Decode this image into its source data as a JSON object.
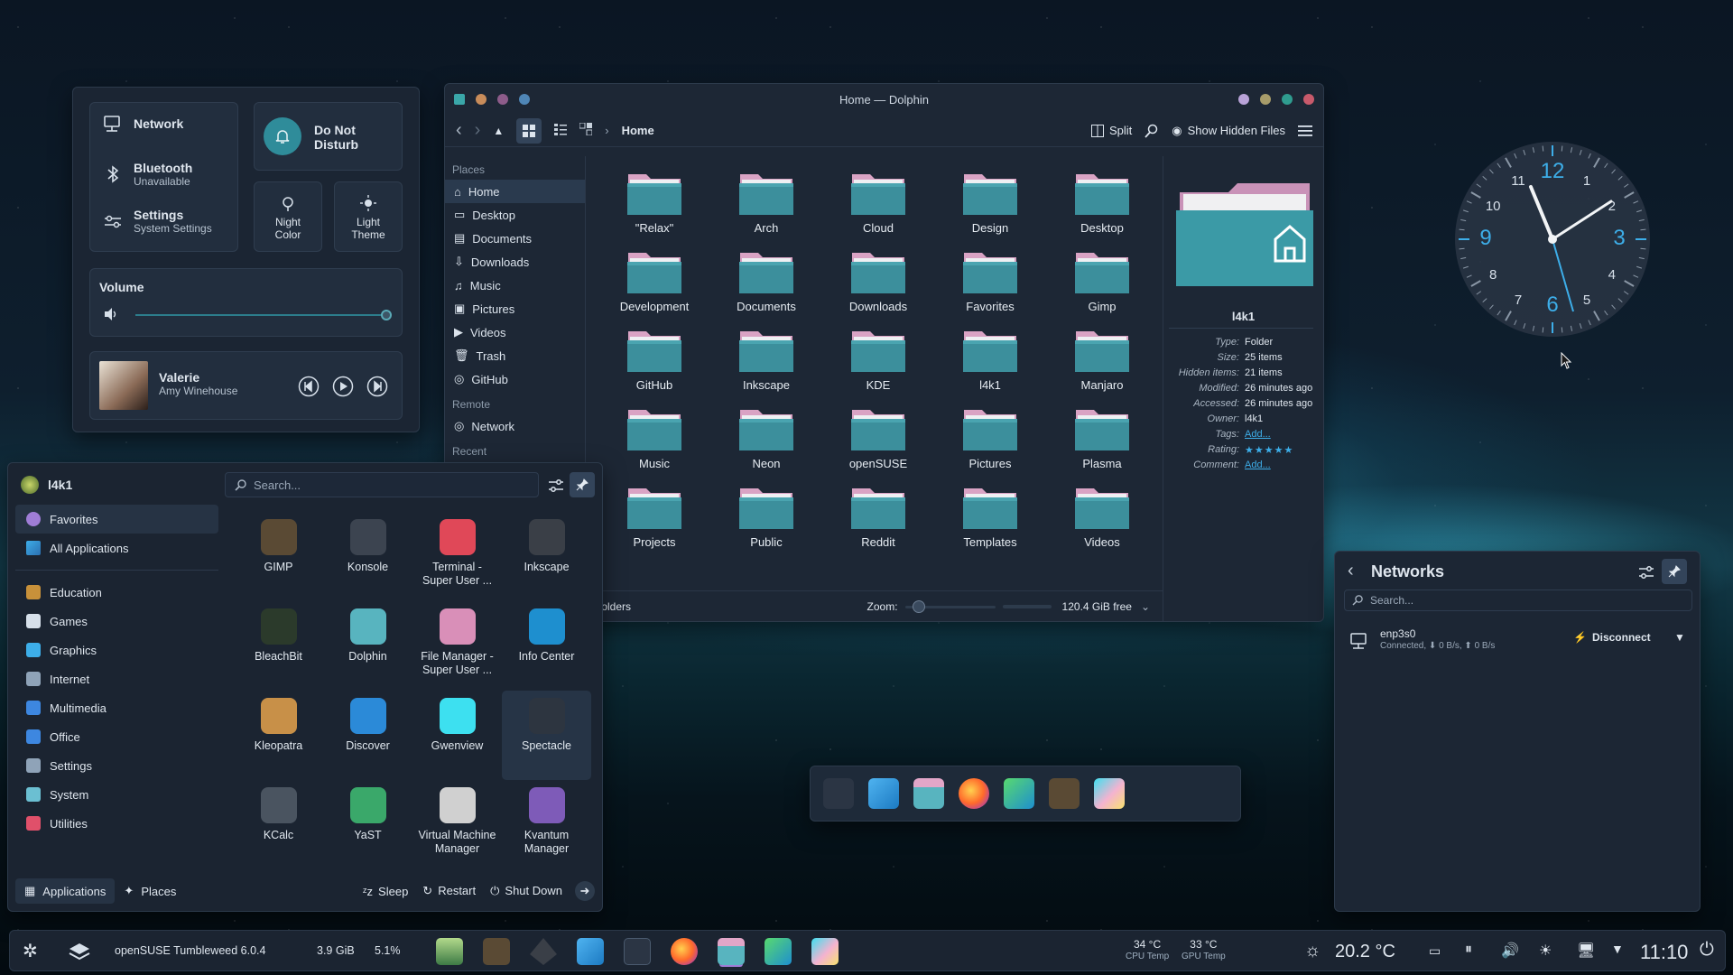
{
  "quick_settings": {
    "network_label": "Network",
    "bluetooth_label": "Bluetooth",
    "bluetooth_status": "Unavailable",
    "settings_label": "Settings",
    "settings_sub": "System Settings",
    "dnd_label_1": "Do Not",
    "dnd_label_2": "Disturb",
    "night_label_1": "Night",
    "night_label_2": "Color",
    "light_label_1": "Light",
    "light_label_2": "Theme",
    "volume_label": "Volume",
    "volume_level": 1.0,
    "media_title": "Valerie",
    "media_artist": "Amy Winehouse"
  },
  "dolphin": {
    "title": "Home — Dolphin",
    "breadcrumb": "Home",
    "split_label": "Split",
    "hidden_label": "Show Hidden Files",
    "places_header": "Places",
    "places": [
      "Home",
      "Desktop",
      "Documents",
      "Downloads",
      "Music",
      "Pictures",
      "Videos",
      "Trash",
      "GitHub"
    ],
    "remote_header": "Remote",
    "remote": [
      "Network"
    ],
    "recent_header": "Recent",
    "folders": [
      "\"Relax\"",
      "Arch",
      "Cloud",
      "Design",
      "Desktop",
      "Development",
      "Documents",
      "Downloads",
      "Favorites",
      "Gimp",
      "GitHub",
      "Inkscape",
      "KDE",
      "l4k1",
      "Manjaro",
      "Music",
      "Neon",
      "openSUSE",
      "Pictures",
      "Plasma",
      "Projects",
      "Public",
      "Reddit",
      "Templates",
      "Videos"
    ],
    "status_text": "folders",
    "zoom_label": "Zoom:",
    "zoom_level": 0.1,
    "free_space": "120.4 GiB free",
    "info": {
      "name": "l4k1",
      "rows": [
        [
          "Type:",
          "Folder"
        ],
        [
          "Size:",
          "25 items"
        ],
        [
          "Hidden items:",
          "21 items"
        ],
        [
          "Modified:",
          "26 minutes ago"
        ],
        [
          "Accessed:",
          "26 minutes ago"
        ],
        [
          "Owner:",
          "l4k1"
        ],
        [
          "Tags:",
          "Add..."
        ],
        [
          "Rating:",
          ""
        ],
        [
          "Comment:",
          "Add..."
        ]
      ]
    }
  },
  "launcher": {
    "user": "l4k1",
    "search_placeholder": "Search...",
    "favorites": "Favorites",
    "all_apps": "All Applications",
    "categories": [
      "Education",
      "Games",
      "Graphics",
      "Internet",
      "Multimedia",
      "Office",
      "Settings",
      "System",
      "Utilities"
    ],
    "apps": [
      [
        "GIMP"
      ],
      [
        "Konsole"
      ],
      [
        "Terminal -",
        "Super User ..."
      ],
      [
        "Inkscape"
      ],
      [
        "BleachBit"
      ],
      [
        "Dolphin"
      ],
      [
        "File Manager -",
        "Super User ..."
      ],
      [
        "Info Center"
      ],
      [
        "Kleopatra"
      ],
      [
        "Discover"
      ],
      [
        "Gwenview"
      ],
      [
        "Spectacle"
      ],
      [
        "KCalc"
      ],
      [
        "YaST"
      ],
      [
        "Virtual Machine",
        "Manager"
      ],
      [
        "Kvantum",
        "Manager"
      ]
    ],
    "tab_applications": "Applications",
    "tab_places": "Places",
    "sleep": "Sleep",
    "restart": "Restart",
    "shutdown": "Shut Down"
  },
  "networks": {
    "title": "Networks",
    "search_placeholder": "Search...",
    "conn_name": "enp3s0",
    "conn_status": "Connected, ⬇ 0 B/s, ⬆ 0 B/s",
    "disconnect": "Disconnect"
  },
  "clock_numbers": [
    "12",
    "1",
    "2",
    "3",
    "4",
    "5",
    "6",
    "7",
    "8",
    "9",
    "10",
    "11"
  ],
  "taskbar": {
    "distro": "openSUSE Tumbleweed 6.0.4",
    "ram": "3.9 GiB",
    "cpu": "5.1%",
    "cpu_temp": "34 °C",
    "cpu_temp_label": "CPU Temp",
    "gpu_temp": "33 °C",
    "gpu_temp_label": "GPU Temp",
    "weather": "20.2 °C",
    "time": "11:10"
  },
  "colors": {
    "accent": "#3daee9",
    "folder_teal": "#3c8f9c",
    "folder_pink": "#d9a3c4"
  }
}
